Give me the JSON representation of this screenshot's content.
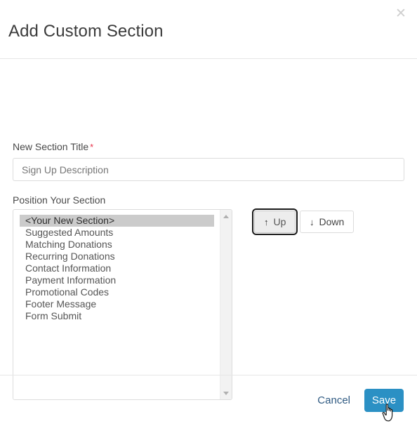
{
  "dialog": {
    "title": "Add Custom Section",
    "close_icon": "close-x-icon"
  },
  "form": {
    "section_title": {
      "label": "New Section Title",
      "required_marker": "*",
      "placeholder": "Sign Up Description",
      "value": ""
    },
    "position": {
      "label": "Position Your Section",
      "items": [
        {
          "label": "<Your New Section>",
          "selected": true
        },
        {
          "label": "Suggested Amounts",
          "selected": false
        },
        {
          "label": "Matching Donations",
          "selected": false
        },
        {
          "label": "Recurring Donations",
          "selected": false
        },
        {
          "label": "Contact Information",
          "selected": false
        },
        {
          "label": "Payment Information",
          "selected": false
        },
        {
          "label": "Promotional Codes",
          "selected": false
        },
        {
          "label": "Footer Message",
          "selected": false
        },
        {
          "label": "Form Submit",
          "selected": false
        }
      ],
      "scrollbar": {
        "up_arrow_icon": "caret-up-icon",
        "down_arrow_icon": "caret-down-icon"
      }
    },
    "move_buttons": {
      "up": {
        "label": "Up",
        "icon": "arrow-up-icon",
        "glyph": "↑",
        "focused": true
      },
      "down": {
        "label": "Down",
        "icon": "arrow-down-icon",
        "glyph": "↓",
        "focused": false
      }
    }
  },
  "footer": {
    "cancel_label": "Cancel",
    "save_label": "Save"
  },
  "colors": {
    "primary": "#2b90c4",
    "required": "#e8334a",
    "link": "#2f5a82",
    "selection": "#cbcbcb",
    "border": "#dcdcdc"
  },
  "cursor": {
    "type": "pointing-hand"
  }
}
